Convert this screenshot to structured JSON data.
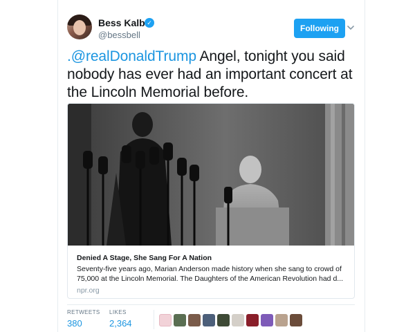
{
  "user": {
    "name": "Bess Kalb",
    "handle": "@bessbell",
    "verified_icon": "verified-badge-icon"
  },
  "actions": {
    "follow_label": "Following",
    "menu_icon": "chevron-down-icon"
  },
  "tweet": {
    "mention": ".@realDonaldTrump",
    "text": " Angel, tonight you said nobody has ever had an important concert at the Lincoln Memorial before."
  },
  "card": {
    "title": "Denied A Stage, She Sang For A Nation",
    "description": "Seventy-five years ago, Marian Anderson made history when she sang to crowd of 75,000 at the Lincoln Memorial. The Daughters of the American Revolution had d...",
    "domain": "npr.org"
  },
  "stats": {
    "retweets_label": "RETWEETS",
    "retweets_value": "380",
    "likes_label": "LIKES",
    "likes_value": "2,364"
  },
  "colors": {
    "accent": "#1da1f2",
    "link": "#1b95e0"
  }
}
